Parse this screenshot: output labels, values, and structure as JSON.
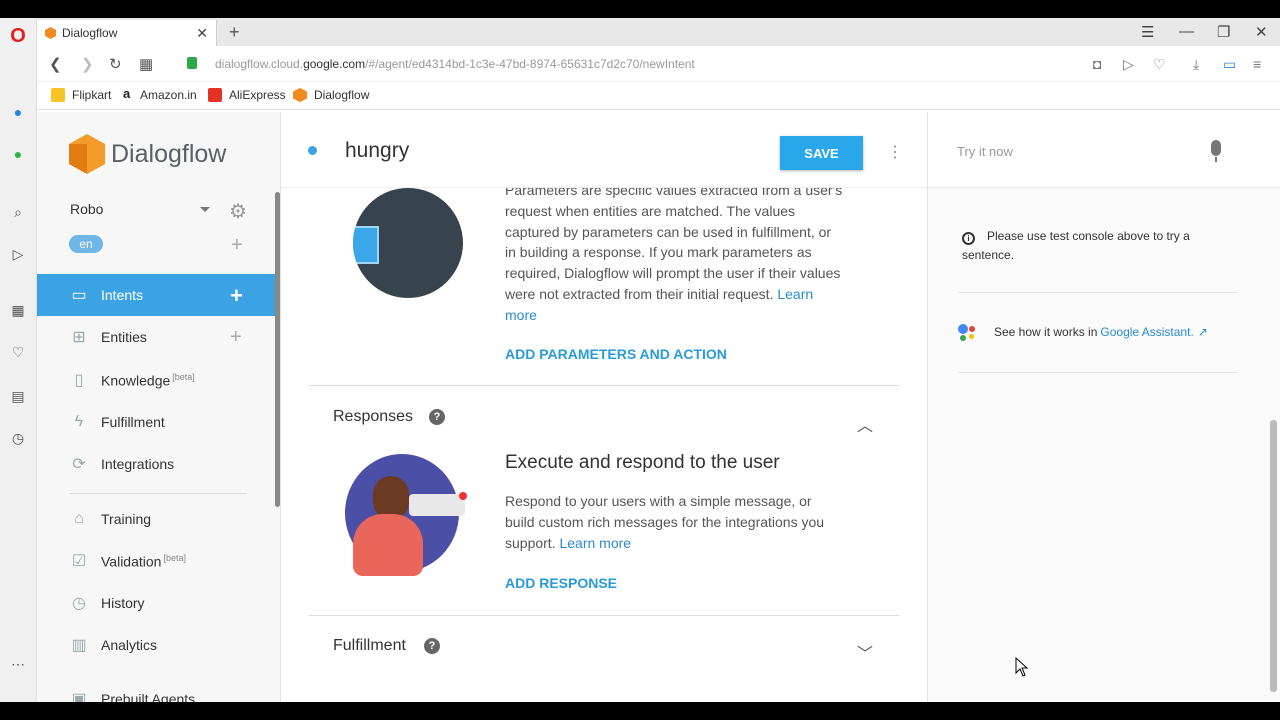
{
  "browser": {
    "tab_title": "Dialogflow",
    "url_pre": "dialogflow.cloud.",
    "url_host": "google.com",
    "url_post": "/#/agent/ed4314bd-1c3e-47bd-8974-65631c7d2c70/newIntent",
    "bookmarks": [
      {
        "label": "Flipkart",
        "color": "#f7c325"
      },
      {
        "label": "Amazon.in",
        "color": "#222222"
      },
      {
        "label": "AliExpress",
        "color": "#e43225"
      },
      {
        "label": "Dialogflow",
        "color": "#f28b1f"
      }
    ]
  },
  "sidebar": {
    "logo_text": "Dialogflow",
    "agent_name": "Robo",
    "language": "en",
    "items": [
      {
        "label": "Intents",
        "icon": "chat-icon"
      },
      {
        "label": "Entities",
        "icon": "hierarchy-icon"
      },
      {
        "label": "Knowledge",
        "beta": "[beta]",
        "icon": "book-icon"
      },
      {
        "label": "Fulfillment",
        "icon": "bolt-icon"
      },
      {
        "label": "Integrations",
        "icon": "sync-icon"
      },
      {
        "label": "Training",
        "icon": "graduation-cap-icon"
      },
      {
        "label": "Validation",
        "beta": "[beta]",
        "icon": "check-box-icon"
      },
      {
        "label": "History",
        "icon": "clock-icon"
      },
      {
        "label": "Analytics",
        "icon": "bar-chart-icon"
      },
      {
        "label": "Prebuilt Agents",
        "icon": "agent-icon"
      }
    ]
  },
  "main": {
    "intent_name": "hungry",
    "save_label": "SAVE",
    "params_text": "Parameters are specific values extracted from a user's request when entities are matched. The values captured by parameters can be used in fulfillment, or in building a response. If you mark parameters as required, Dialogflow will prompt the user if their values were not extracted from their initial request.",
    "learn_more": "Learn more",
    "add_params": "ADD PARAMETERS AND ACTION",
    "responses_title": "Responses",
    "responses_heading": "Execute and respond to the user",
    "responses_text": "Respond to your users with a simple message, or build custom rich messages for the integrations you support.",
    "add_response": "ADD RESPONSE",
    "fulfillment_title": "Fulfillment"
  },
  "right": {
    "try_placeholder": "Try it now",
    "info_text": "Please use test console above to try a sentence.",
    "see_how": "See how it works in ",
    "google_assistant": "Google Assistant."
  }
}
